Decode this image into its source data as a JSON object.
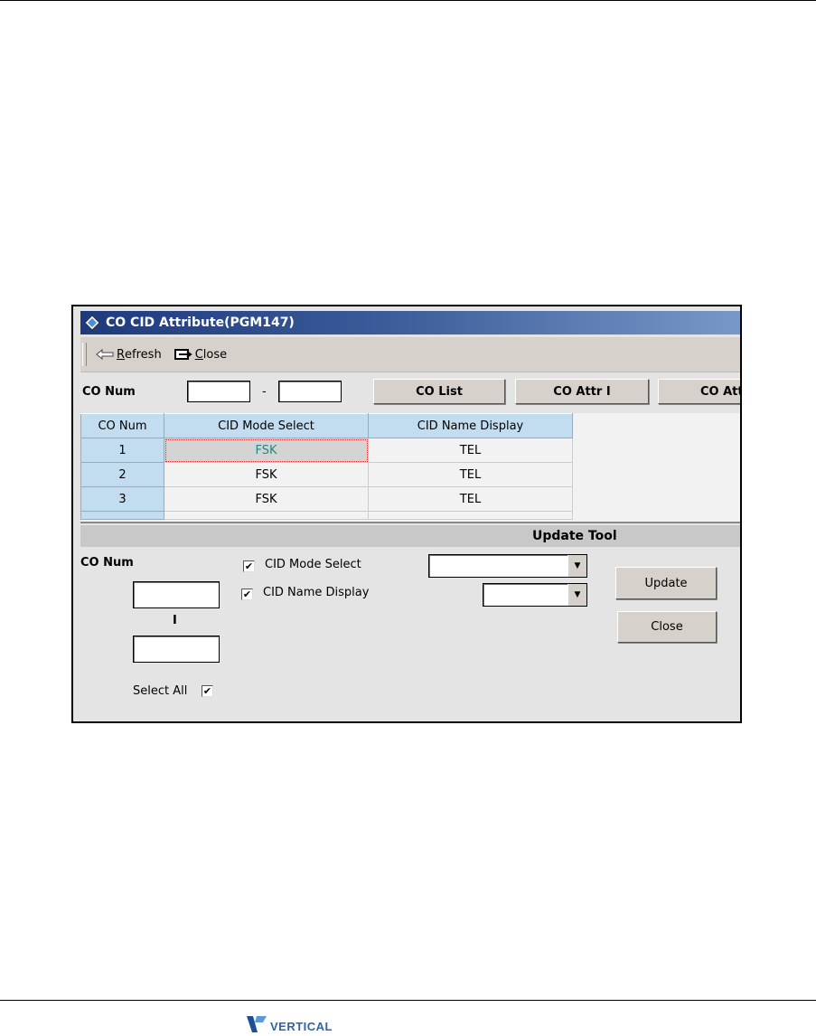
{
  "window": {
    "title": "CO CID Attribute(PGM147)"
  },
  "toolbar": {
    "refresh_label": "Refresh",
    "refresh_mnemonic": "R",
    "refresh_rest": "efresh",
    "close_label": "Close",
    "close_mnemonic": "C",
    "close_rest": "lose"
  },
  "filter": {
    "label": "CO Num",
    "from_value": "",
    "separator": "-",
    "to_value": "",
    "buttons": [
      "CO List",
      "CO Attr I",
      "CO Attr"
    ]
  },
  "grid": {
    "columns": [
      "CO Num",
      "CID Mode Select",
      "CID Name Display"
    ],
    "rows": [
      {
        "co_num": "1",
        "cid_mode": "FSK",
        "cid_name": "TEL"
      },
      {
        "co_num": "2",
        "cid_mode": "FSK",
        "cid_name": "TEL"
      },
      {
        "co_num": "3",
        "cid_mode": "FSK",
        "cid_name": "TEL"
      }
    ],
    "selected_cell": {
      "row": 0,
      "column": "CID Mode Select"
    }
  },
  "update_tool": {
    "header": "Update Tool",
    "co_num_label": "CO Num",
    "from_value": "",
    "range_separator": "I",
    "to_value": "",
    "select_all_label": "Select All",
    "select_all_checked": true,
    "fields": [
      {
        "label": "CID Mode Select",
        "checked": true,
        "value": ""
      },
      {
        "label": "CID Name Display",
        "checked": true,
        "value": ""
      }
    ],
    "update_button": "Update",
    "close_button": "Close"
  },
  "footer": {
    "logo_text": "VERTICAL",
    "brand_color": "#2f63a8"
  },
  "colors": {
    "title_gradient_start": "#1d3a7e",
    "title_gradient_end": "#7898c8",
    "header_cell": "#c2ddef",
    "selected_text": "#1f8a80"
  }
}
